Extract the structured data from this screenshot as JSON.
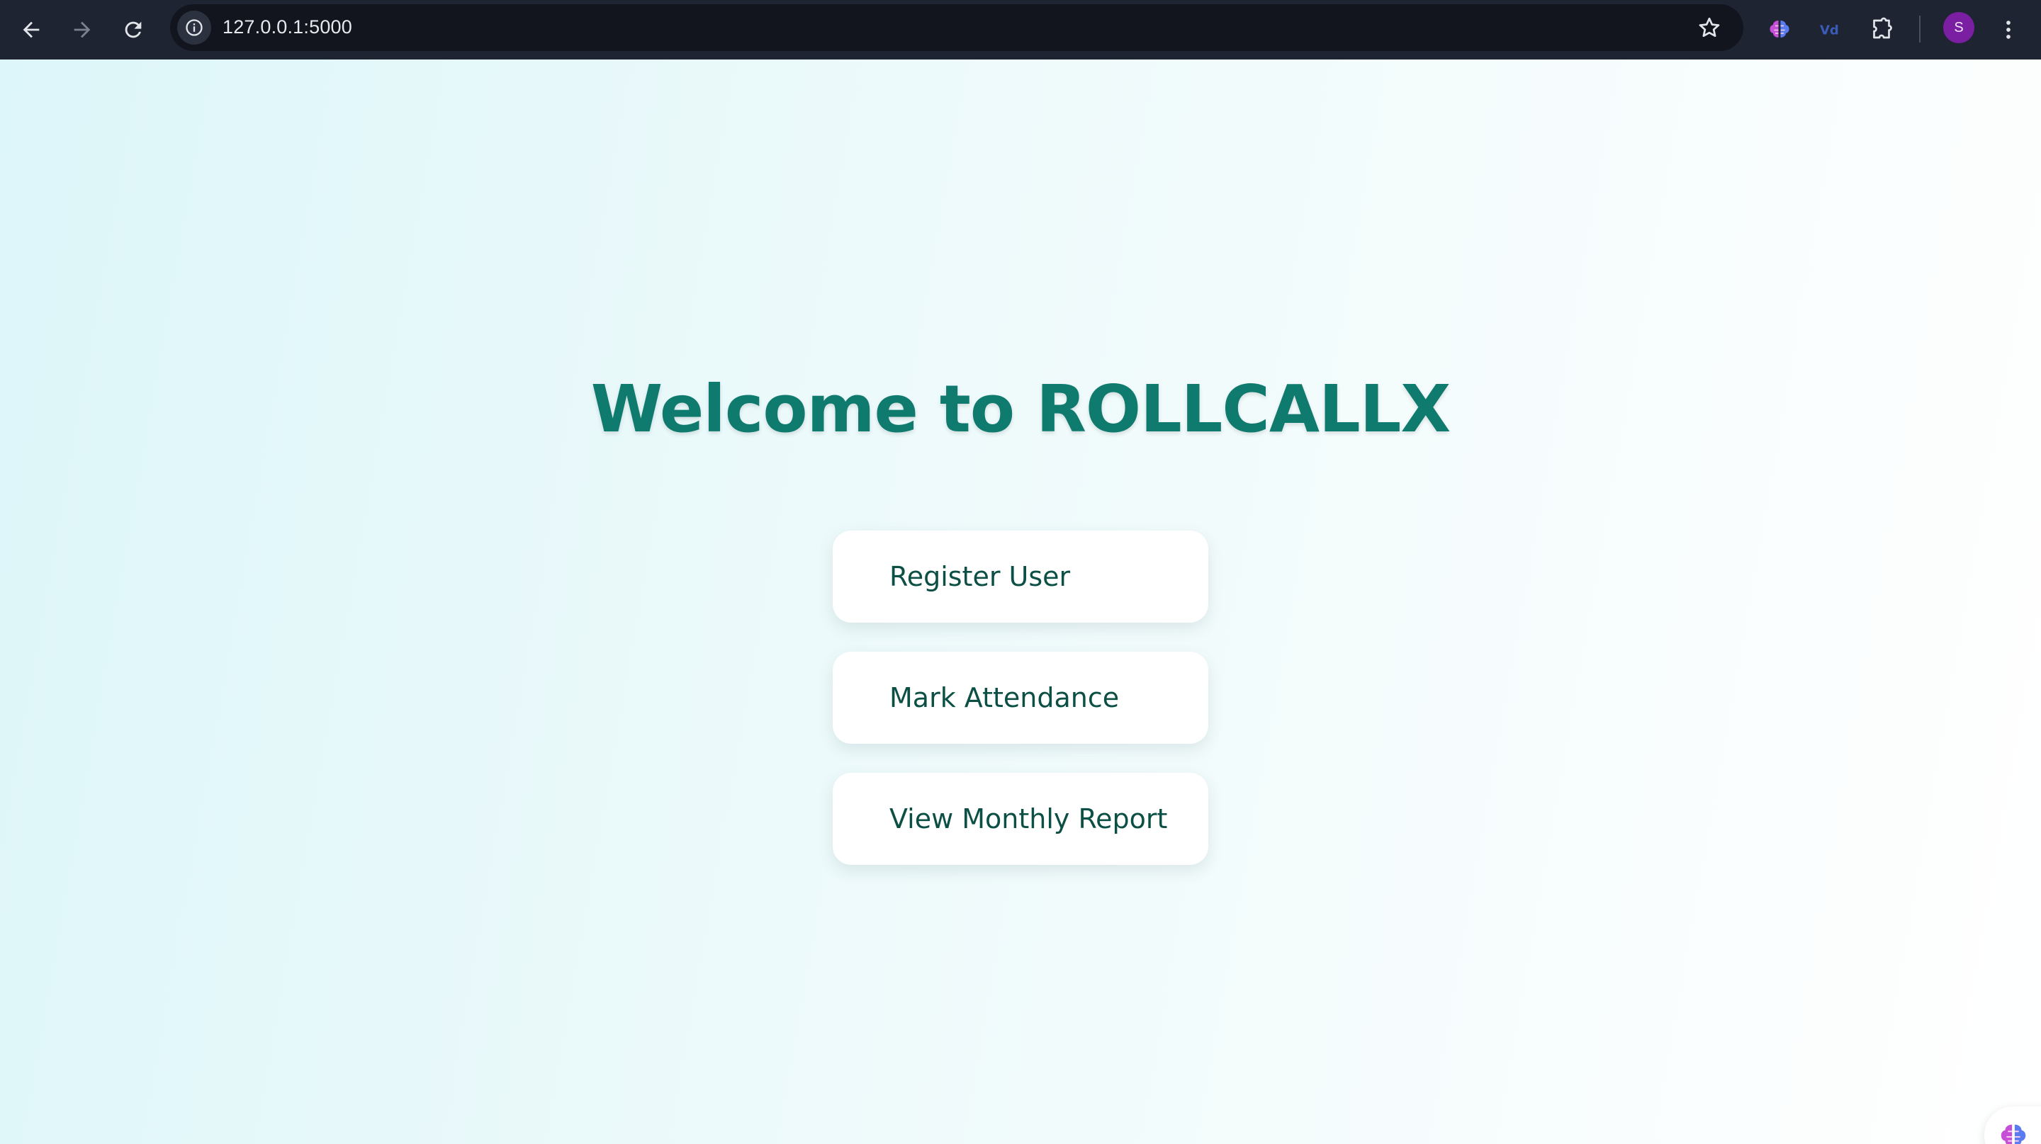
{
  "browser": {
    "url": "127.0.0.1:5000",
    "profile_initial": "S",
    "icons": [
      "back-arrow-icon",
      "forward-arrow-icon",
      "reload-icon",
      "site-info-icon",
      "bookmark-star-icon",
      "brain-extension-icon",
      "vue-extension-icon",
      "extensions-puzzle-icon",
      "more-menu-icon"
    ]
  },
  "page": {
    "title": "Welcome to ROLLCALLX",
    "buttons": {
      "register": "Register User",
      "attendance": "Mark Attendance",
      "report": "View Monthly Report"
    }
  },
  "colors": {
    "title": "#0f7a6e",
    "button_text": "#0c4f44",
    "background_start": "#ddf6f9",
    "background_end": "#ffffff"
  }
}
